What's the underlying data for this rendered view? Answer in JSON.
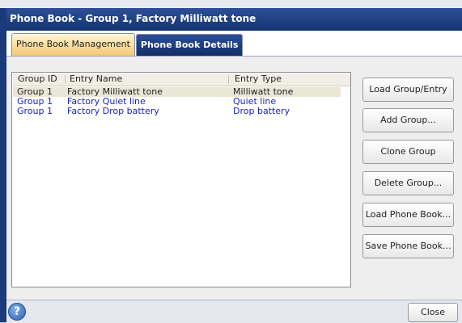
{
  "window": {
    "title": "Phone Book - Group 1, Factory Milliwatt tone"
  },
  "tabs": [
    {
      "label": "Phone Book Management",
      "active": true
    },
    {
      "label": "Phone Book Details",
      "active": false
    }
  ],
  "table": {
    "columns": [
      "Group ID",
      "Entry Name",
      "Entry Type"
    ],
    "rows": [
      {
        "group": "Group 1",
        "name": "Factory Milliwatt tone",
        "type": "Milliwatt tone",
        "selected": true
      },
      {
        "group": "Group 1",
        "name": "Factory Quiet line",
        "type": "Quiet line",
        "selected": false
      },
      {
        "group": "Group 1",
        "name": "Factory Drop battery",
        "type": "Drop battery",
        "selected": false
      }
    ]
  },
  "actions": {
    "load_group_entry": "Load Group/Entry",
    "add_group": "Add Group...",
    "clone_group": "Clone Group",
    "delete_group": "Delete Group...",
    "load_phone_book": "Load Phone Book...",
    "save_phone_book": "Save Phone Book..."
  },
  "footer": {
    "help_icon": "help-icon",
    "help_glyph": "?",
    "close_label": "Close"
  },
  "colors": {
    "title_bar": "#1b3a7a",
    "tab_active": "#f3c870",
    "row_text": "#1a24b8",
    "row_selected": "#ebe6d6"
  }
}
